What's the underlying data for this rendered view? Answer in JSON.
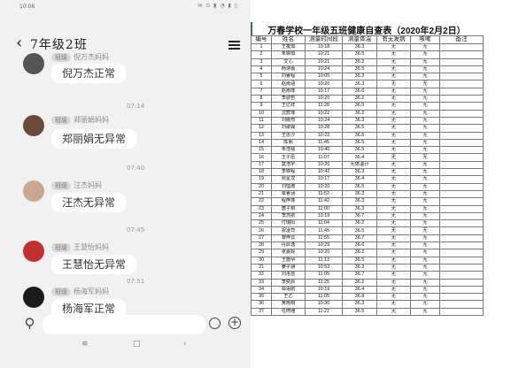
{
  "phone": {
    "status_time": "10:06",
    "status_icons": "✉ ⊙ ▮ ◔ ▮ ▯",
    "back_glyph": "‹",
    "chat_title": "7年级2班",
    "messages": [
      {
        "sender_tag": "班级",
        "sender": "倪万杰妈妈",
        "text": "倪万杰正常",
        "avatar_color": "#555555"
      },
      {
        "sender_tag": "班级",
        "sender": "郑丽娟妈妈",
        "text": "郑丽娟无异常",
        "avatar_color": "#6b4a3a",
        "time_before": "07:14"
      },
      {
        "sender_tag": "班级",
        "sender": "汪杰妈妈",
        "text": "汪杰无异常",
        "avatar_color": "#c8a890",
        "time_before": "07:40"
      },
      {
        "sender_tag": "班级",
        "sender": "王慧怡妈妈",
        "text": "王慧怡无异常",
        "avatar_color": "#c03030",
        "time_before": "07:45"
      },
      {
        "sender_tag": "班级",
        "sender": "杨海军妈妈",
        "text": "杨海军正常",
        "avatar_color": "#1a1a1a",
        "time_before": "07:51"
      }
    ],
    "nav": {
      "menu": "≡",
      "home": "□",
      "back": "‹"
    }
  },
  "sheet": {
    "title": "万春学校一年级五班健康自查表（2020年2月2日）",
    "columns": [
      "编号",
      "姓名",
      "测量时间段",
      "测量体温",
      "有无发病",
      "咳嗽",
      "备注"
    ],
    "rows": [
      [
        "1",
        "王筱琪",
        "10:18",
        "36.3",
        "无",
        "无",
        ""
      ],
      [
        "2",
        "朱锦琪",
        "10:21",
        "36.5",
        "无",
        "无",
        ""
      ],
      [
        "3",
        "文心",
        "10:21",
        "36.2",
        "无",
        "无",
        ""
      ],
      [
        "4",
        "杨诗蕾",
        "10:24",
        "36.5",
        "无",
        "无",
        ""
      ],
      [
        "5",
        "刘睿程",
        "10:05",
        "36.3",
        "无",
        "无",
        ""
      ],
      [
        "6",
        "赵雨涵",
        "10:20",
        "36.3",
        "无",
        "无",
        ""
      ],
      [
        "7",
        "赵雨菲",
        "10:17",
        "36.6",
        "无",
        "无",
        ""
      ],
      [
        "8",
        "李骁哲",
        "10:20",
        "36.2",
        "无",
        "无",
        ""
      ],
      [
        "9",
        "王亿祥",
        "11:28",
        "36.5",
        "无",
        "无",
        ""
      ],
      [
        "10",
        "沈宸菲",
        "10:22",
        "36.2",
        "无",
        "无",
        ""
      ],
      [
        "11",
        "刘婉然",
        "10:24",
        "36.3",
        "无",
        "无",
        ""
      ],
      [
        "12",
        "刘歌霖",
        "10:28",
        "36.5",
        "无",
        "无",
        ""
      ],
      [
        "13",
        "王思汐",
        "10:22",
        "36.6",
        "无",
        "无",
        ""
      ],
      [
        "14",
        "陈朋",
        "11:45",
        "36.5",
        "无",
        "无",
        ""
      ],
      [
        "15",
        "朱浩铭",
        "10:40",
        "36.5",
        "无",
        "无",
        ""
      ],
      [
        "16",
        "王子臣",
        "11:07",
        "36.4",
        "无",
        "无",
        ""
      ],
      [
        "17",
        "莫浩宇",
        "10:20",
        "无体温计",
        "无",
        "无",
        ""
      ],
      [
        "18",
        "李锦程",
        "10:42",
        "36.3",
        "无",
        "无",
        ""
      ],
      [
        "19",
        "阮星龙",
        "10:17",
        "36.4",
        "无",
        "无",
        ""
      ],
      [
        "20",
        "刘理澈",
        "10:20",
        "36.5",
        "无",
        "无",
        ""
      ],
      [
        "21",
        "覃睿涵",
        "11:52",
        "36.3",
        "无",
        "无",
        ""
      ],
      [
        "22",
        "程梓菲",
        "11:42",
        "36.3",
        "无",
        "无",
        ""
      ],
      [
        "23",
        "唐子桐",
        "11:00",
        "36.3",
        "无",
        "无",
        ""
      ],
      [
        "24",
        "李苏航",
        "10:19",
        "36.7",
        "无",
        "无",
        ""
      ],
      [
        "25",
        "付瑞阳",
        "11:04",
        "36.2",
        "无",
        "无",
        ""
      ],
      [
        "26",
        "祝凌司",
        "11:45",
        "36.5",
        "无",
        "无",
        ""
      ],
      [
        "27",
        "黎梓云",
        "11:55",
        "36.7",
        "无",
        "无",
        ""
      ],
      [
        "28",
        "丹辰逸",
        "10:29",
        "36.6",
        "无",
        "无",
        ""
      ],
      [
        "29",
        "张嘉妮",
        "10:20",
        "36.2",
        "无",
        "无",
        ""
      ],
      [
        "30",
        "王施孕",
        "11:13",
        "36.5",
        "无",
        "无",
        ""
      ],
      [
        "31",
        "姜子骐",
        "10:53",
        "36.3",
        "无",
        "无",
        ""
      ],
      [
        "32",
        "刘洛芸",
        "11:05",
        "36.7",
        "无",
        "无",
        ""
      ],
      [
        "33",
        "李奕辰",
        "11:25",
        "36.2",
        "无",
        "无",
        ""
      ],
      [
        "34",
        "郑语航",
        "10:19",
        "36.4",
        "无",
        "无",
        ""
      ],
      [
        "35",
        "王乙",
        "11:05",
        "36.8",
        "无",
        "无",
        ""
      ],
      [
        "36",
        "黄雨桐",
        "10:30",
        "36.3",
        "无",
        "无",
        ""
      ],
      [
        "37",
        "任珂雅",
        "11:22",
        "36.5",
        "无",
        "无",
        ""
      ]
    ]
  }
}
